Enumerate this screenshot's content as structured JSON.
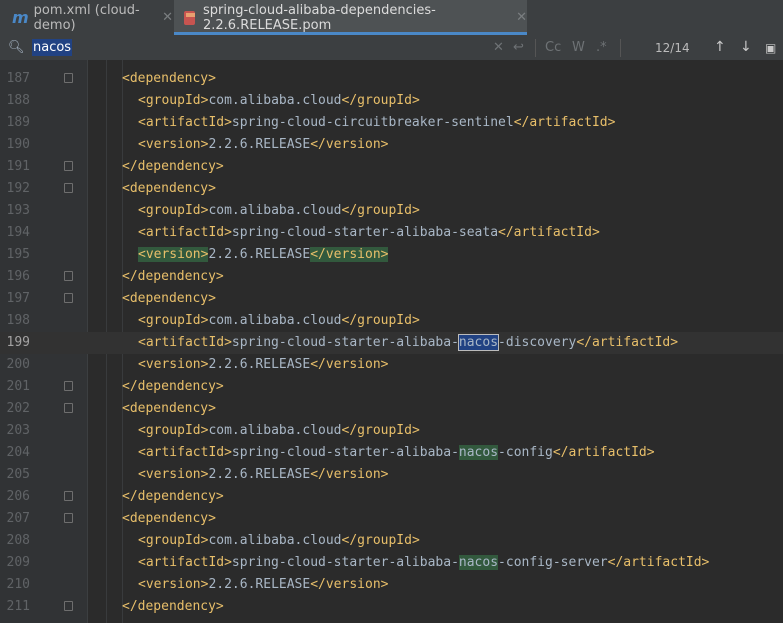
{
  "tabs": [
    {
      "label": "pom.xml (cloud-demo)",
      "icon": "maven-icon",
      "active": false
    },
    {
      "label": "spring-cloud-alibaba-dependencies-2.2.6.RELEASE.pom",
      "icon": "pom-file-icon",
      "active": true
    }
  ],
  "search": {
    "query": "nacos",
    "match_count": "12/14",
    "options": [
      "Cc",
      "W",
      ".*"
    ]
  },
  "colors": {
    "tag": "#e8bf6a",
    "text": "#a9b7c6",
    "match_highlight": "#32593d",
    "current_match": "#214283"
  },
  "code_lines": [
    {
      "num": "187",
      "indent": 1,
      "parts": [
        {
          "t": "<dependency>",
          "c": "tag"
        }
      ]
    },
    {
      "num": "188",
      "indent": 2,
      "parts": [
        {
          "t": "<groupId>",
          "c": "tag"
        },
        {
          "t": "com.alibaba.cloud",
          "c": "txt"
        },
        {
          "t": "</groupId>",
          "c": "tag"
        }
      ]
    },
    {
      "num": "189",
      "indent": 2,
      "parts": [
        {
          "t": "<artifactId>",
          "c": "tag"
        },
        {
          "t": "spring-cloud-circuitbreaker-sentinel",
          "c": "txt"
        },
        {
          "t": "</artifactId>",
          "c": "tag"
        }
      ]
    },
    {
      "num": "190",
      "indent": 2,
      "parts": [
        {
          "t": "<version>",
          "c": "tag"
        },
        {
          "t": "2.2.6.RELEASE",
          "c": "txt"
        },
        {
          "t": "</version>",
          "c": "tag"
        }
      ]
    },
    {
      "num": "191",
      "indent": 1,
      "parts": [
        {
          "t": "</dependency>",
          "c": "tag"
        }
      ]
    },
    {
      "num": "192",
      "indent": 1,
      "parts": [
        {
          "t": "<dependency>",
          "c": "tag"
        }
      ]
    },
    {
      "num": "193",
      "indent": 2,
      "parts": [
        {
          "t": "<groupId>",
          "c": "tag"
        },
        {
          "t": "com.alibaba.cloud",
          "c": "txt"
        },
        {
          "t": "</groupId>",
          "c": "tag"
        }
      ]
    },
    {
      "num": "194",
      "indent": 2,
      "parts": [
        {
          "t": "<artifactId>",
          "c": "tag"
        },
        {
          "t": "spring-cloud-starter-alibaba-seata",
          "c": "txt"
        },
        {
          "t": "</artifactId>",
          "c": "tag"
        }
      ]
    },
    {
      "num": "195",
      "indent": 2,
      "parts": [
        {
          "t": "<version>",
          "c": "tag",
          "hl": "green"
        },
        {
          "t": "2.2.6.RELEASE",
          "c": "txt"
        },
        {
          "t": "</version>",
          "c": "tag",
          "hl": "green"
        }
      ]
    },
    {
      "num": "196",
      "indent": 1,
      "parts": [
        {
          "t": "</dependency>",
          "c": "tag"
        }
      ]
    },
    {
      "num": "197",
      "indent": 1,
      "parts": [
        {
          "t": "<dependency>",
          "c": "tag"
        }
      ]
    },
    {
      "num": "198",
      "indent": 2,
      "parts": [
        {
          "t": "<groupId>",
          "c": "tag"
        },
        {
          "t": "com.alibaba.cloud",
          "c": "txt"
        },
        {
          "t": "</groupId>",
          "c": "tag"
        }
      ]
    },
    {
      "num": "199",
      "indent": 2,
      "current": true,
      "parts": [
        {
          "t": "<artifactId>",
          "c": "tag"
        },
        {
          "t": "spring-cloud-starter-alibaba-",
          "c": "txt"
        },
        {
          "t": "nacos",
          "c": "txt",
          "hl": "cur"
        },
        {
          "t": "-discovery",
          "c": "txt"
        },
        {
          "t": "</artifactId>",
          "c": "tag"
        }
      ]
    },
    {
      "num": "200",
      "indent": 2,
      "parts": [
        {
          "t": "<version>",
          "c": "tag"
        },
        {
          "t": "2.2.6.RELEASE",
          "c": "txt"
        },
        {
          "t": "</version>",
          "c": "tag"
        }
      ]
    },
    {
      "num": "201",
      "indent": 1,
      "parts": [
        {
          "t": "</dependency>",
          "c": "tag"
        }
      ]
    },
    {
      "num": "202",
      "indent": 1,
      "parts": [
        {
          "t": "<dependency>",
          "c": "tag"
        }
      ]
    },
    {
      "num": "203",
      "indent": 2,
      "parts": [
        {
          "t": "<groupId>",
          "c": "tag"
        },
        {
          "t": "com.alibaba.cloud",
          "c": "txt"
        },
        {
          "t": "</groupId>",
          "c": "tag"
        }
      ]
    },
    {
      "num": "204",
      "indent": 2,
      "parts": [
        {
          "t": "<artifactId>",
          "c": "tag"
        },
        {
          "t": "spring-cloud-starter-alibaba-",
          "c": "txt"
        },
        {
          "t": "nacos",
          "c": "txt",
          "hl": "green"
        },
        {
          "t": "-config",
          "c": "txt"
        },
        {
          "t": "</artifactId>",
          "c": "tag"
        }
      ]
    },
    {
      "num": "205",
      "indent": 2,
      "parts": [
        {
          "t": "<version>",
          "c": "tag"
        },
        {
          "t": "2.2.6.RELEASE",
          "c": "txt"
        },
        {
          "t": "</version>",
          "c": "tag"
        }
      ]
    },
    {
      "num": "206",
      "indent": 1,
      "parts": [
        {
          "t": "</dependency>",
          "c": "tag"
        }
      ]
    },
    {
      "num": "207",
      "indent": 1,
      "parts": [
        {
          "t": "<dependency>",
          "c": "tag"
        }
      ]
    },
    {
      "num": "208",
      "indent": 2,
      "parts": [
        {
          "t": "<groupId>",
          "c": "tag"
        },
        {
          "t": "com.alibaba.cloud",
          "c": "txt"
        },
        {
          "t": "</groupId>",
          "c": "tag"
        }
      ]
    },
    {
      "num": "209",
      "indent": 2,
      "parts": [
        {
          "t": "<artifactId>",
          "c": "tag"
        },
        {
          "t": "spring-cloud-starter-alibaba-",
          "c": "txt"
        },
        {
          "t": "nacos",
          "c": "txt",
          "hl": "green"
        },
        {
          "t": "-config-server",
          "c": "txt"
        },
        {
          "t": "</artifactId>",
          "c": "tag"
        }
      ]
    },
    {
      "num": "210",
      "indent": 2,
      "parts": [
        {
          "t": "<version>",
          "c": "tag"
        },
        {
          "t": "2.2.6.RELEASE",
          "c": "txt"
        },
        {
          "t": "</version>",
          "c": "tag"
        }
      ]
    },
    {
      "num": "211",
      "indent": 1,
      "parts": [
        {
          "t": "</dependency>",
          "c": "tag"
        }
      ]
    }
  ],
  "fold_lines": [
    "187",
    "191",
    "192",
    "196",
    "197",
    "201",
    "202",
    "206",
    "207",
    "211"
  ]
}
